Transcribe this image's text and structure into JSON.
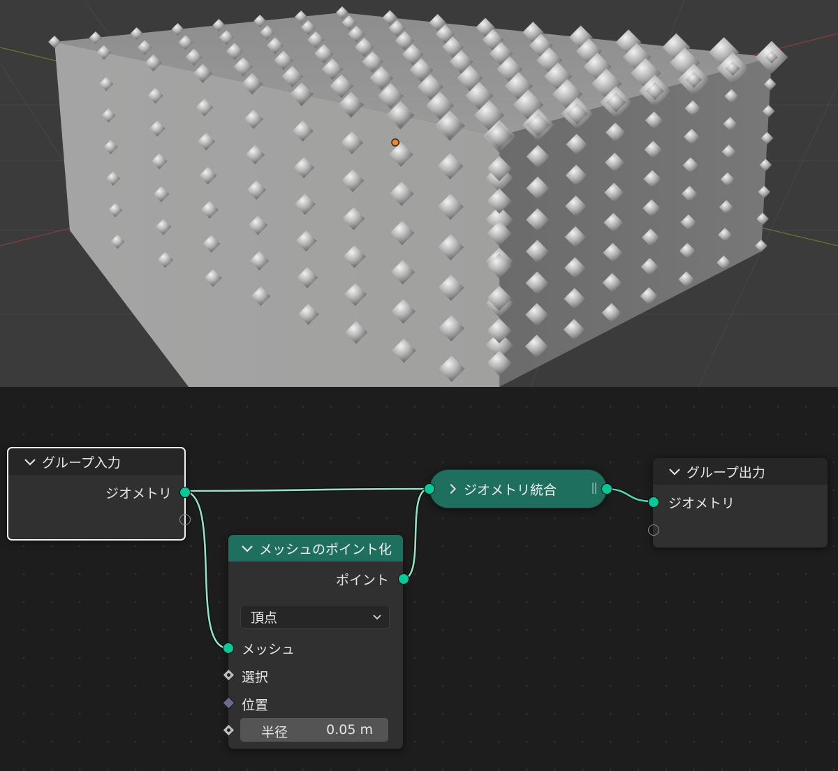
{
  "nodes": {
    "group_input": {
      "title": "グループ入力",
      "outputs": [
        "ジオメトリ"
      ]
    },
    "mesh_to_points": {
      "title": "メッシュのポイント化",
      "output": "ポイント",
      "mode": "頂点",
      "inputs": {
        "mesh": "メッシュ",
        "selection": "選択",
        "position": "位置"
      },
      "radius": {
        "label": "半径",
        "value": "0.05 m"
      }
    },
    "join_geometry": {
      "title": "ジオメトリ統合"
    },
    "group_output": {
      "title": "グループ出力",
      "inputs": [
        "ジオメトリ"
      ]
    }
  },
  "colors": {
    "geometry_socket": "#00c896",
    "join_node": "#1f6f5f",
    "mesh_to_points_header": "#1f6f5f",
    "editor_bg": "#1d1d1d",
    "viewport_bg": "#3b3b3b"
  },
  "icons": [
    "chevron-down-icon",
    "chevron-right-icon",
    "grip-icon"
  ]
}
